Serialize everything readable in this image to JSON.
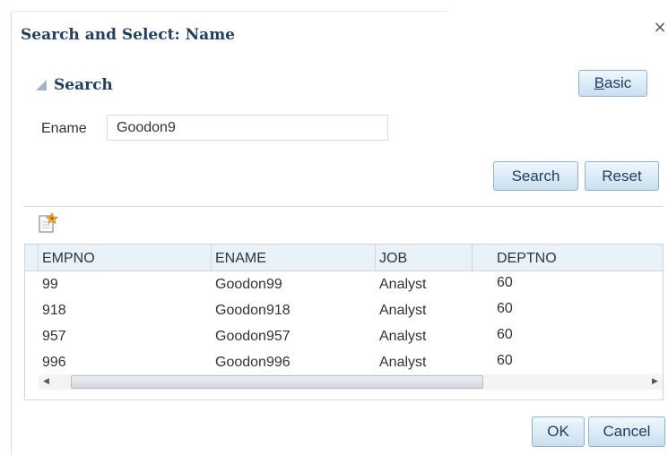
{
  "dialog": {
    "title": "Search and Select: Name",
    "close_icon": "×"
  },
  "search": {
    "header": "Search",
    "basic_label": "Basic",
    "ename_label": "Ename",
    "ename_value": "Goodon9",
    "search_label": "Search",
    "reset_label": "Reset"
  },
  "table": {
    "create_icon": "create-row-icon",
    "columns": [
      "EMPNO",
      "ENAME",
      "JOB",
      "DEPTNO"
    ],
    "rows": [
      [
        "99",
        "Goodon99",
        "Analyst",
        "60"
      ],
      [
        "918",
        "Goodon918",
        "Analyst",
        "60"
      ],
      [
        "957",
        "Goodon957",
        "Analyst",
        "60"
      ],
      [
        "996",
        "Goodon996",
        "Analyst",
        "60"
      ]
    ],
    "scroll_left": "◀",
    "scroll_right": "▶"
  },
  "footer": {
    "ok_label": "OK",
    "cancel_label": "Cancel"
  },
  "colors": {
    "title": "#1f3f63",
    "button_border": "#8eb3cf",
    "header_bg": "#eaf2f9"
  }
}
